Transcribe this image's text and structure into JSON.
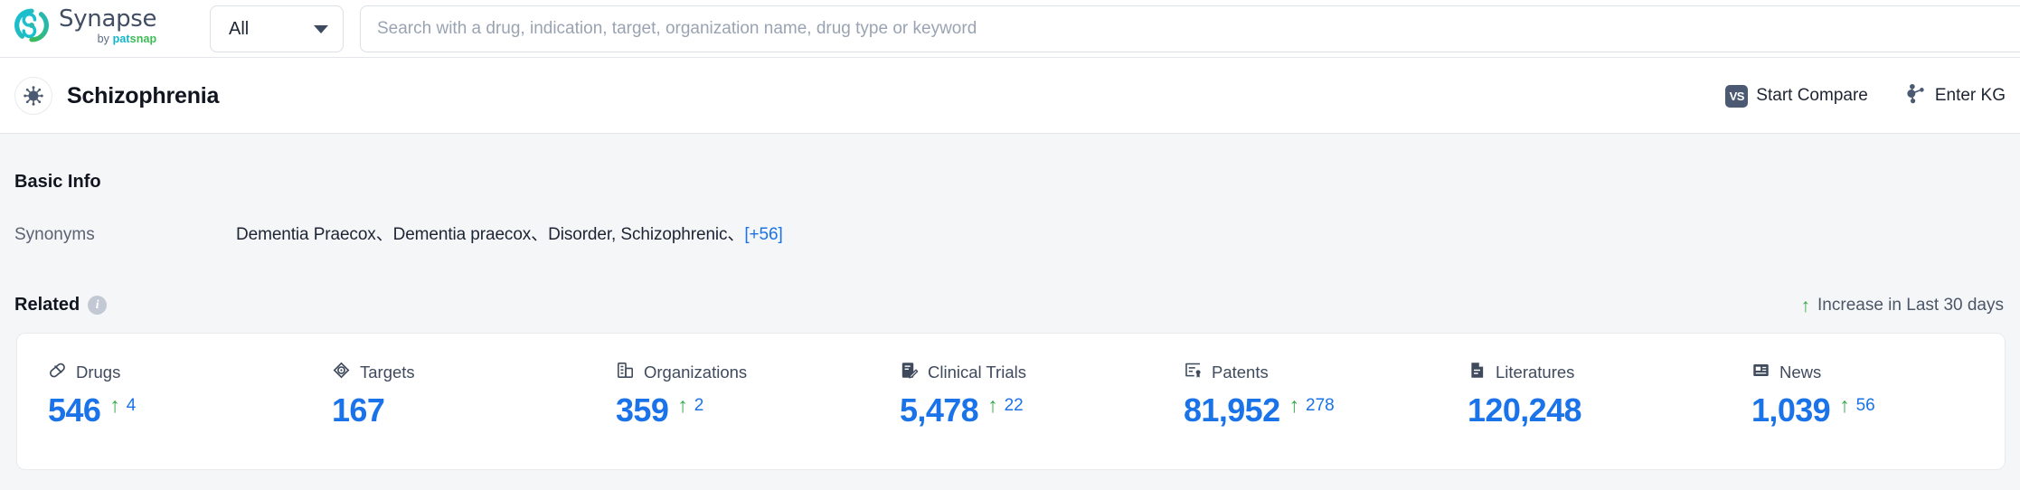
{
  "topnav": {
    "brand_name": "Synapse",
    "brand_by": "by ",
    "brand_pat": "pat",
    "brand_snap": "snap",
    "scope_value": "All",
    "search_placeholder": "Search with a drug, indication, target, organization name, drug type or keyword",
    "search_value": ""
  },
  "entity": {
    "title": "Schizophrenia",
    "icon": "virus-icon",
    "actions": [
      {
        "label": "Start Compare",
        "badge": "VS",
        "icon": "vs-badge-icon"
      },
      {
        "label": "Enter KG",
        "icon": "knowledge-graph-icon"
      }
    ]
  },
  "basic_info": {
    "title": "Basic Info",
    "synonyms_label": "Synonyms",
    "synonyms_value": "Dementia Praecox、Dementia praecox、Disorder, Schizophrenic、",
    "synonyms_more": "[+56]"
  },
  "related": {
    "title": "Related",
    "info_icon": "info-icon",
    "legend_arrow": "↑",
    "legend_text": "Increase in Last 30 days",
    "cards": [
      {
        "label": "Drugs",
        "icon": "pill-icon",
        "value": "546",
        "delta": "4",
        "delta_arrow": "↑"
      },
      {
        "label": "Targets",
        "icon": "target-icon",
        "value": "167",
        "delta": "",
        "delta_arrow": ""
      },
      {
        "label": "Organizations",
        "icon": "building-icon",
        "value": "359",
        "delta": "2",
        "delta_arrow": "↑"
      },
      {
        "label": "Clinical Trials",
        "icon": "clinical-trial-icon",
        "value": "5,478",
        "delta": "22",
        "delta_arrow": "↑"
      },
      {
        "label": "Patents",
        "icon": "patent-icon",
        "value": "81,952",
        "delta": "278",
        "delta_arrow": "↑"
      },
      {
        "label": "Literatures",
        "icon": "document-icon",
        "value": "120,248",
        "delta": "",
        "delta_arrow": ""
      },
      {
        "label": "News",
        "icon": "news-icon",
        "value": "1,039",
        "delta": "56",
        "delta_arrow": "↑"
      }
    ]
  },
  "colors": {
    "accent_blue": "#1a73e8",
    "increase_green": "#35aa47",
    "text_dark": "#10151f",
    "text_muted": "#5b6373",
    "border": "#e8eaee",
    "logo_cyan": "#12b6c8",
    "logo_green": "#3dbb55"
  }
}
